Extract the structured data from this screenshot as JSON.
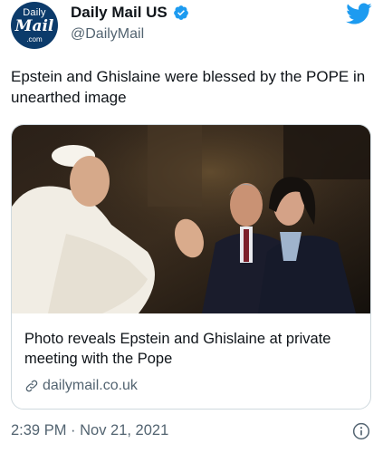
{
  "author": {
    "avatar": {
      "line1": "Daily",
      "line2": "Mail",
      "line3": ".com"
    },
    "display_name": "Daily Mail US",
    "handle": "@DailyMail",
    "verified_icon": "verified-badge-icon"
  },
  "tweet": {
    "text": "Epstein and Ghislaine were blessed by the POPE in unearthed image"
  },
  "card": {
    "title": "Photo reveals Epstein and Ghislaine at private meeting with the Pope",
    "domain": "dailymail.co.uk",
    "domain_icon": "link-icon"
  },
  "footer": {
    "timestamp": "2:39 PM · Nov 21, 2021",
    "info_icon": "info-icon"
  },
  "colors": {
    "brand_blue": "#1d9bf0",
    "secondary_text": "#536471",
    "avatar_bg": "#0c3b6b"
  }
}
